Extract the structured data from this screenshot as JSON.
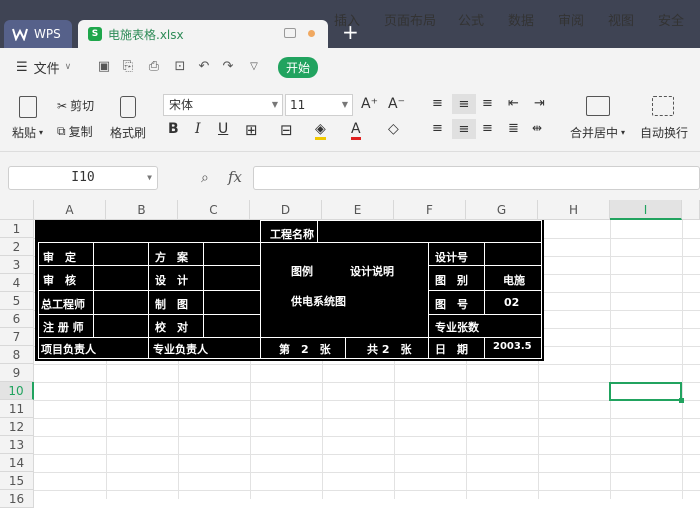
{
  "titlebar": {
    "app_tab": "WPS",
    "file_tab": "电施表格.xlsx",
    "file_icon_letter": "S"
  },
  "menu": {
    "file": "文件",
    "items": [
      "开始",
      "插入",
      "页面布局",
      "公式",
      "数据",
      "审阅",
      "视图",
      "安全"
    ]
  },
  "ribbon": {
    "paste": "粘贴",
    "cut": "剪切",
    "copy": "复制",
    "format_painter": "格式刷",
    "font_name": "宋体",
    "font_size": "11",
    "merge_center": "合并居中",
    "wrap_text": "自动换行"
  },
  "formula_bar": {
    "cell_ref": "I10",
    "fx": "fx",
    "content": ""
  },
  "columns": [
    "A",
    "B",
    "C",
    "D",
    "E",
    "F",
    "G",
    "H",
    "I"
  ],
  "rows": [
    "1",
    "2",
    "3",
    "4",
    "5",
    "6",
    "7",
    "8",
    "9",
    "10",
    "11",
    "12",
    "13",
    "14",
    "15",
    "16"
  ],
  "title_block": {
    "project_name": "工程名称",
    "shending": "审　定",
    "shenhe": "审　核",
    "zonggong": "总工程师",
    "zhuce": "注 册 师",
    "xiangmu": "项目负责人",
    "fangan": "方　案",
    "sheji": "设　计",
    "zhitu": "制　图",
    "jiaodui": "校　对",
    "zhuanye": "专业负责人",
    "tuli": "图例",
    "shejishuoming": "设计说明",
    "gongdian": "供电系统图",
    "di": "第　2　张",
    "gong": "共 2　张",
    "shejihao": "设计号",
    "tubie": "图　别",
    "tubie_val": "电施",
    "tuhao": "图　号",
    "tuhao_val": "02",
    "zhuanyezhangshu": "专业张数",
    "riqi": "日　期",
    "riqi_val": "2003.5"
  }
}
